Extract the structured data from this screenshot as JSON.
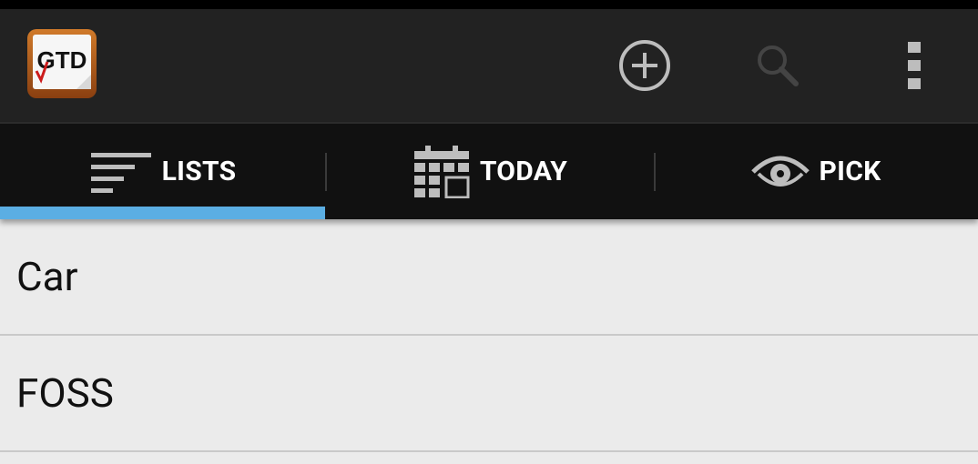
{
  "app": {
    "logo_text": "GTD"
  },
  "actionbar": {
    "icons": [
      "add-circle-icon",
      "search-icon",
      "overflow-menu-icon"
    ]
  },
  "tabs": [
    {
      "label": "LISTS",
      "icon": "lists-icon",
      "selected": true
    },
    {
      "label": "TODAY",
      "icon": "calendar-icon",
      "selected": false
    },
    {
      "label": "PICK",
      "icon": "eye-icon",
      "selected": false
    }
  ],
  "lists": [
    {
      "name": "Car"
    },
    {
      "name": "FOSS"
    }
  ],
  "colors": {
    "accent": "#5baee3",
    "actionbar": "#222222",
    "tabbar": "#111111",
    "background": "#ebebeb"
  }
}
